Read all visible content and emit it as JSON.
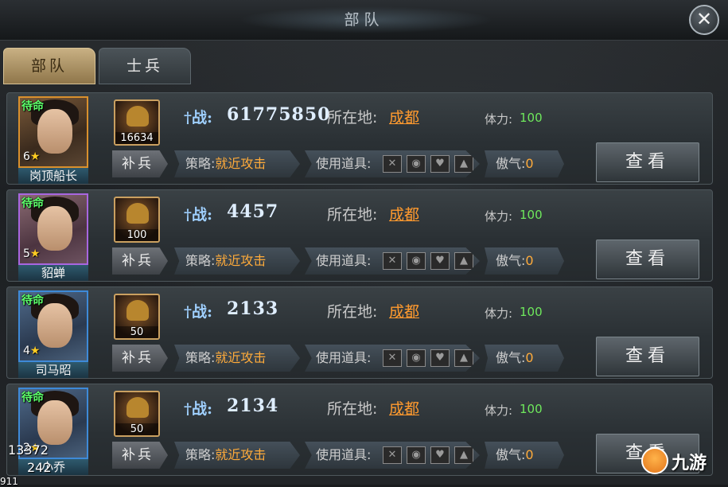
{
  "window": {
    "title": "部队",
    "close_icon": "close-icon"
  },
  "tabs": [
    {
      "label": "部队",
      "active": true
    },
    {
      "label": "士兵",
      "active": false
    }
  ],
  "labels": {
    "power": "战:",
    "location": "所在地:",
    "stamina": "体力:",
    "supply": "补兵",
    "tactic": "策略:",
    "items": "使用道具:",
    "morale": "傲气:",
    "view": "查看"
  },
  "troops": [
    {
      "status": "待命",
      "stars": "6",
      "name": "岗顶船长",
      "soldiers": "16634",
      "power": "61775850",
      "location": "成都",
      "stamina": "100",
      "tactic": "就近攻击",
      "morale": "0",
      "frame": "orange"
    },
    {
      "status": "待命",
      "stars": "5",
      "name": "貂蝉",
      "soldiers": "100",
      "power": "4457",
      "location": "成都",
      "stamina": "100",
      "tactic": "就近攻击",
      "morale": "0",
      "frame": "purple"
    },
    {
      "status": "待命",
      "stars": "4",
      "name": "司马昭",
      "soldiers": "50",
      "power": "2133",
      "location": "成都",
      "stamina": "100",
      "tactic": "就近攻击",
      "morale": "0",
      "frame": "blue"
    },
    {
      "status": "待命",
      "stars": "2",
      "name": "小乔",
      "soldiers": "50",
      "power": "2134",
      "location": "成都",
      "stamina": "100",
      "tactic": "就近攻击",
      "morale": "0",
      "frame": "blue"
    }
  ],
  "overlay": {
    "a": "13372",
    "b": "242",
    "c": "911"
  },
  "watermark": {
    "text": "九游"
  },
  "colors": {
    "status": "#5dff6a",
    "location": "#ff9a2e",
    "stamina": "#6ee85c",
    "tactic": "#ffab3a"
  }
}
